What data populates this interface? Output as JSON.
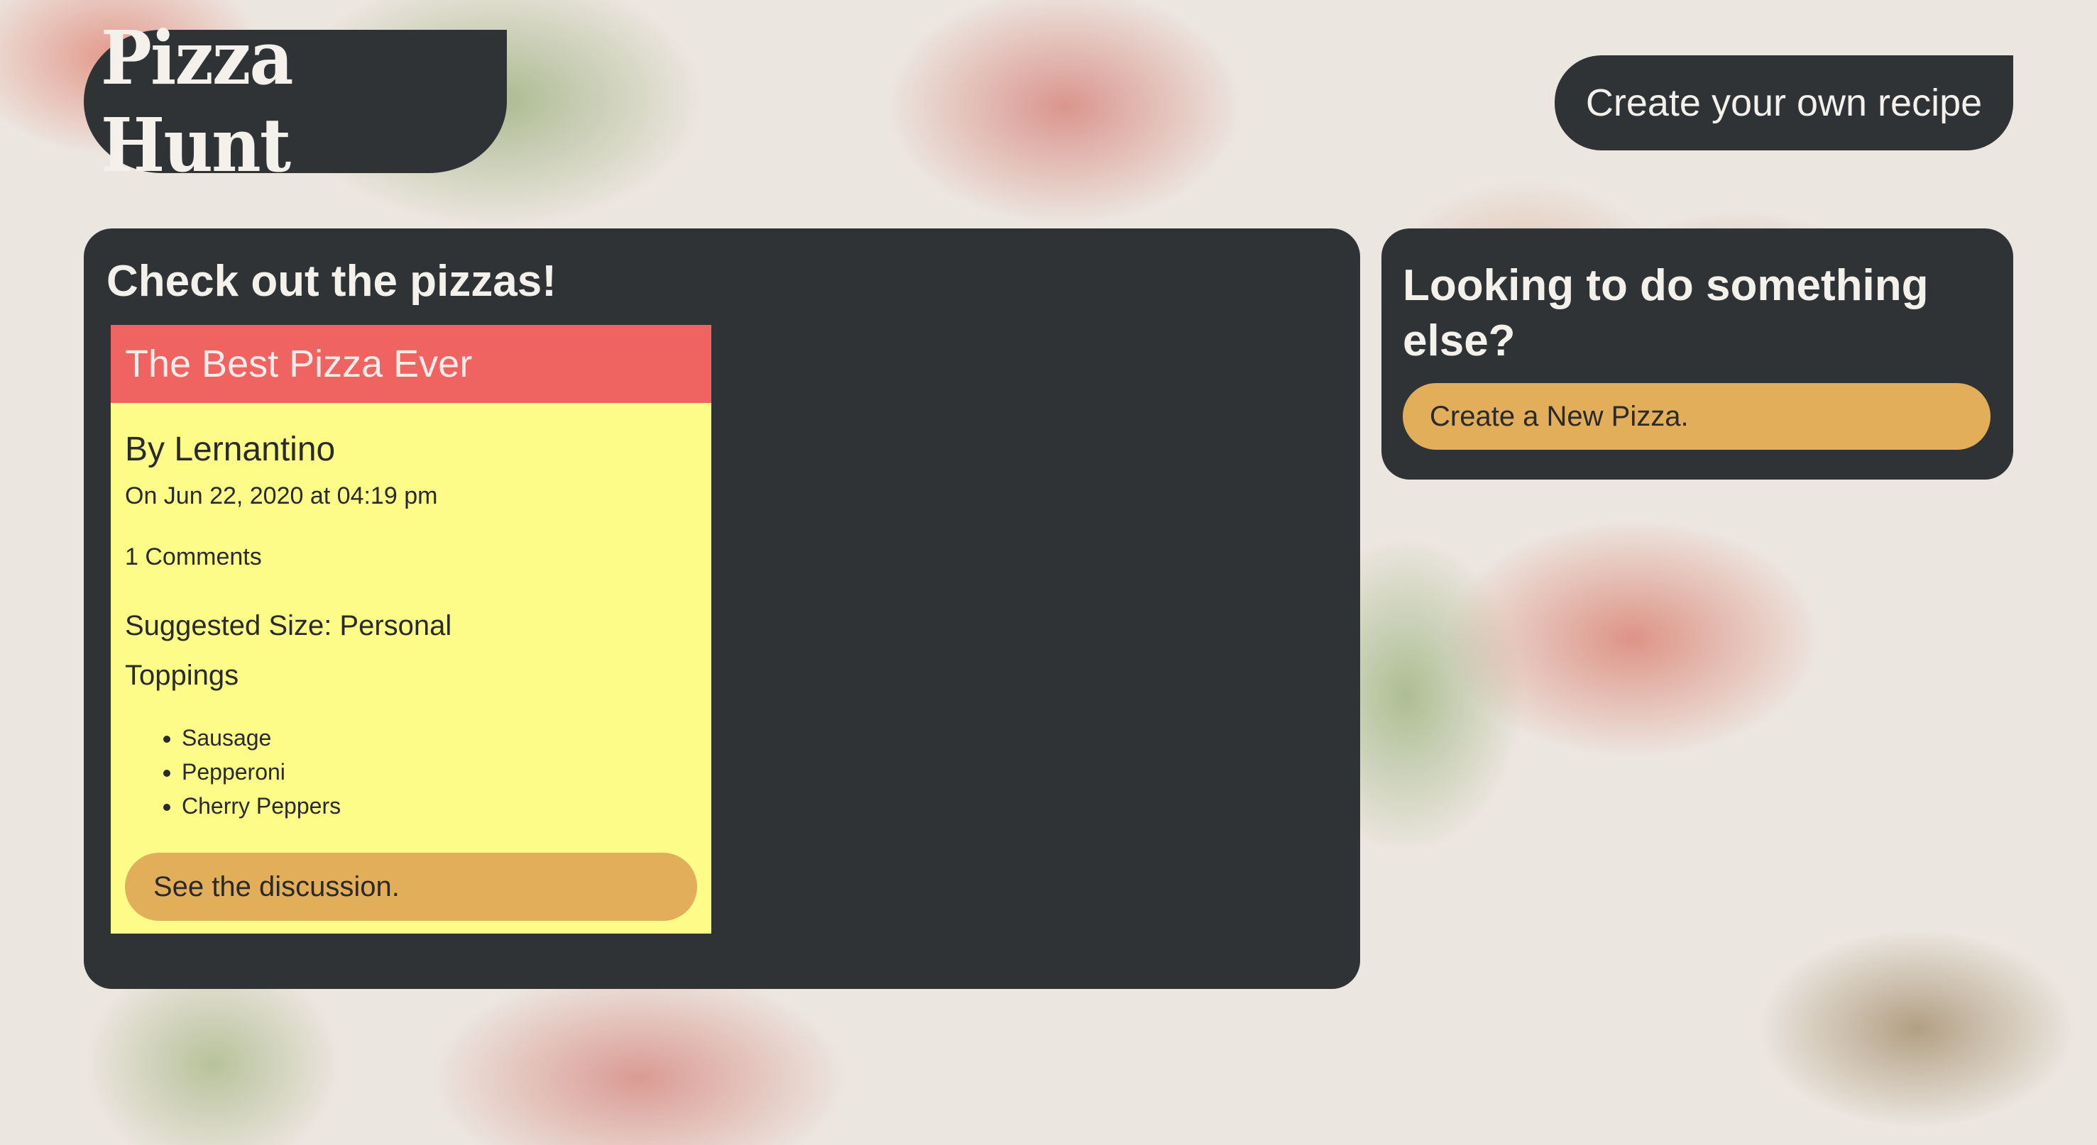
{
  "header": {
    "logo_text": "Pizza Hunt",
    "create_recipe_label": "Create your own recipe"
  },
  "main": {
    "title": "Check out the pizzas!",
    "pizzas": [
      {
        "name": "The Best Pizza Ever",
        "author": "By Lernantino",
        "date": "On Jun 22, 2020 at 04:19 pm",
        "comments": "1 Comments",
        "size": "Suggested Size: Personal",
        "toppings_label": "Toppings",
        "toppings": [
          "Sausage",
          "Pepperoni",
          "Cherry Peppers"
        ],
        "discussion_label": "See the discussion."
      }
    ]
  },
  "sidebar": {
    "title": "Looking to do something else?",
    "new_pizza_label": "Create a New Pizza."
  },
  "colors": {
    "panel": "#2f3336",
    "card_header": "#ef6460",
    "card_body": "#fdfc88",
    "button": "#e3ae5a",
    "light_text": "#f4f0ec"
  }
}
